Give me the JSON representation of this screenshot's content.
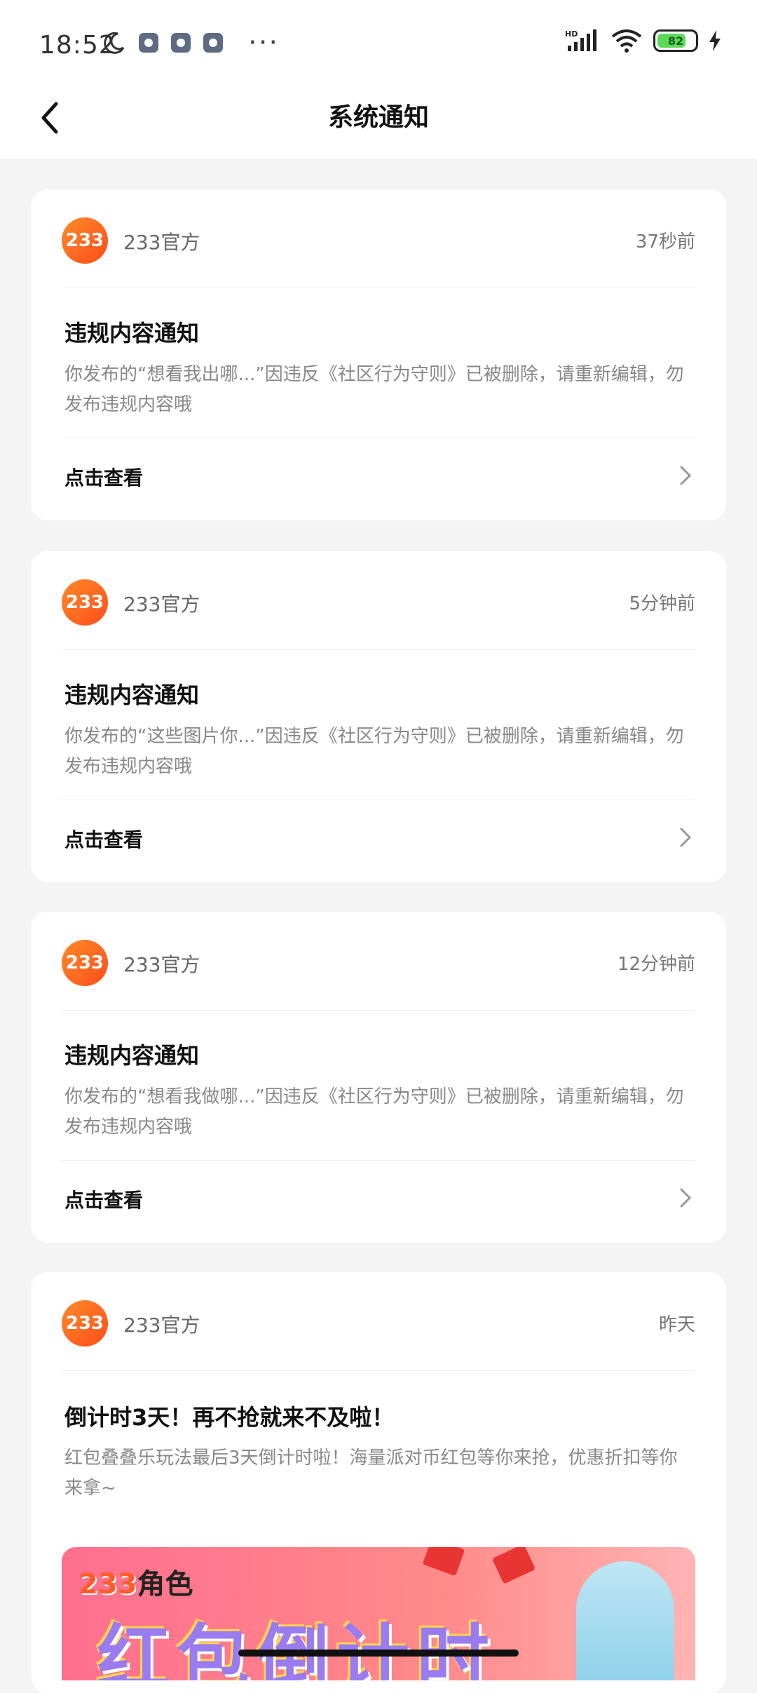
{
  "status_bar": {
    "time": "18:52",
    "battery": "82",
    "network": "HD"
  },
  "header": {
    "title": "系统通知"
  },
  "notifications": [
    {
      "sender": "233官方",
      "time": "37秒前",
      "title": "违规内容通知",
      "body": "你发布的“想看我出哪...”因违反《社区行为守则》已被删除，请重新编辑，勿发布违规内容哦",
      "action": "点击查看"
    },
    {
      "sender": "233官方",
      "time": "5分钟前",
      "title": "违规内容通知",
      "body": "你发布的“这些图片你...”因违反《社区行为守则》已被删除，请重新编辑，勿发布违规内容哦",
      "action": "点击查看"
    },
    {
      "sender": "233官方",
      "time": "12分钟前",
      "title": "违规内容通知",
      "body": "你发布的“想看我做哪...”因违反《社区行为守则》已被删除，请重新编辑，勿发布违规内容哦",
      "action": "点击查看"
    },
    {
      "sender": "233官方",
      "time": "昨天",
      "title": "倒计时3天！再不抢就来不及啦！",
      "body": "红包叠叠乐玩法最后3天倒计时啦！海量派对币红包等你来抢，优惠折扣等你来拿~",
      "banner_brand_a": "233",
      "banner_brand_b": "角色",
      "banner_text": "红包倒计时"
    }
  ],
  "logo_text": "233"
}
